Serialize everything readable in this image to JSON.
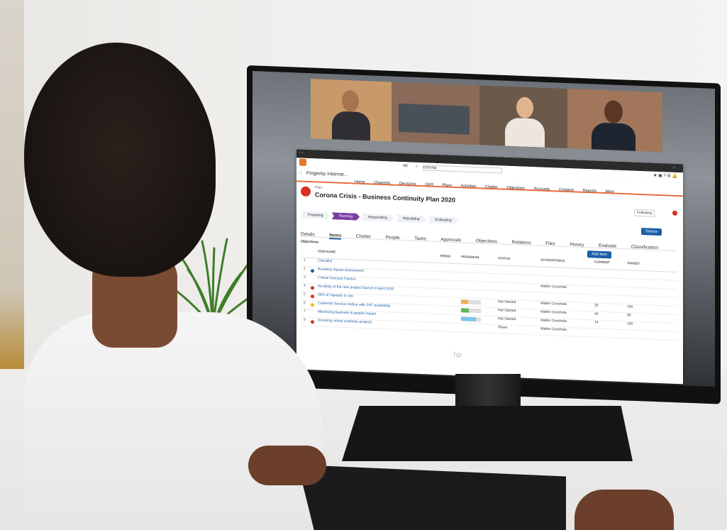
{
  "screen": {
    "video_call": {
      "participants": [
        "",
        "",
        "",
        ""
      ]
    },
    "browser": {
      "search_scope": "All",
      "search_value": "corona",
      "app_name": "Fingertip Interme...",
      "nav": [
        "Home",
        "Channels",
        "Decisions",
        "OKR",
        "Plans",
        "Activities",
        "Chatter",
        "Objectives",
        "Accounts",
        "Contacts",
        "Reports",
        "More"
      ],
      "record_type": "Plan",
      "record_title": "Corona Crisis - Business Continuity Plan 2020",
      "following": "Following",
      "path_stages": [
        {
          "label": "Preparing",
          "active": false
        },
        {
          "label": "Planning",
          "active": true
        },
        {
          "label": "Responding",
          "active": false
        },
        {
          "label": "Rebuilding",
          "active": false
        },
        {
          "label": "Evaluating",
          "active": false
        }
      ],
      "action_button": "Stance",
      "tabs": [
        "Details",
        "Items",
        "Chatter",
        "People",
        "Tasks",
        "Approvals",
        "Objectives",
        "Relations",
        "Files",
        "History",
        "Evaluate",
        "Classification"
      ],
      "active_tab": "Items",
      "filter_label": "Objectives",
      "add_item": "Add Item",
      "columns": [
        "ITEM NAME",
        "TREND",
        "PROGRESS",
        "STATUS",
        "ACCOUNTABLE",
        "CURRENT",
        "TARGET"
      ],
      "rows": [
        {
          "num": "1",
          "name": "Checklist",
          "dot": "",
          "progress": null,
          "status": "",
          "accountable": "",
          "current": "",
          "target": ""
        },
        {
          "num": "2",
          "name": "Business Impact Assessment",
          "dot": "#1b5fa8",
          "progress": null,
          "status": "",
          "accountable": "",
          "current": "",
          "target": ""
        },
        {
          "num": "3",
          "name": "Critical Success Factors",
          "dot": "",
          "progress": null,
          "status": "",
          "accountable": "Walter Conchola",
          "current": "",
          "target": ""
        },
        {
          "num": "4",
          "name": "No delay of the new product launch in April 2020",
          "dot": "#d93025",
          "progress": null,
          "status": "",
          "accountable": "",
          "current": "",
          "target": ""
        },
        {
          "num": "5",
          "name": "50% of capacity in use",
          "dot": "#d93025",
          "progress": 35,
          "status": "Not Started",
          "accountable": "Walter Conchola",
          "current": "35",
          "target": "100"
        },
        {
          "num": "6",
          "name": "Customer Service Hotline with 24/7 availability",
          "dot": "#f2b90c",
          "progress": 40,
          "status": "Not Started",
          "accountable": "Walter Conchola",
          "current": "40",
          "target": "50"
        },
        {
          "num": "7",
          "name": "Minimizing business & people impact",
          "dot": "",
          "progress": 74,
          "status": "Not Started",
          "accountable": "Walter Conchola",
          "current": "74",
          "target": "100"
        },
        {
          "num": "8",
          "name": "Securing critical customer projects",
          "dot": "#d93025",
          "progress": null,
          "status": "Share",
          "accountable": "Walter Conchola",
          "current": "",
          "target": ""
        }
      ]
    },
    "monitor_brand": "hp"
  }
}
